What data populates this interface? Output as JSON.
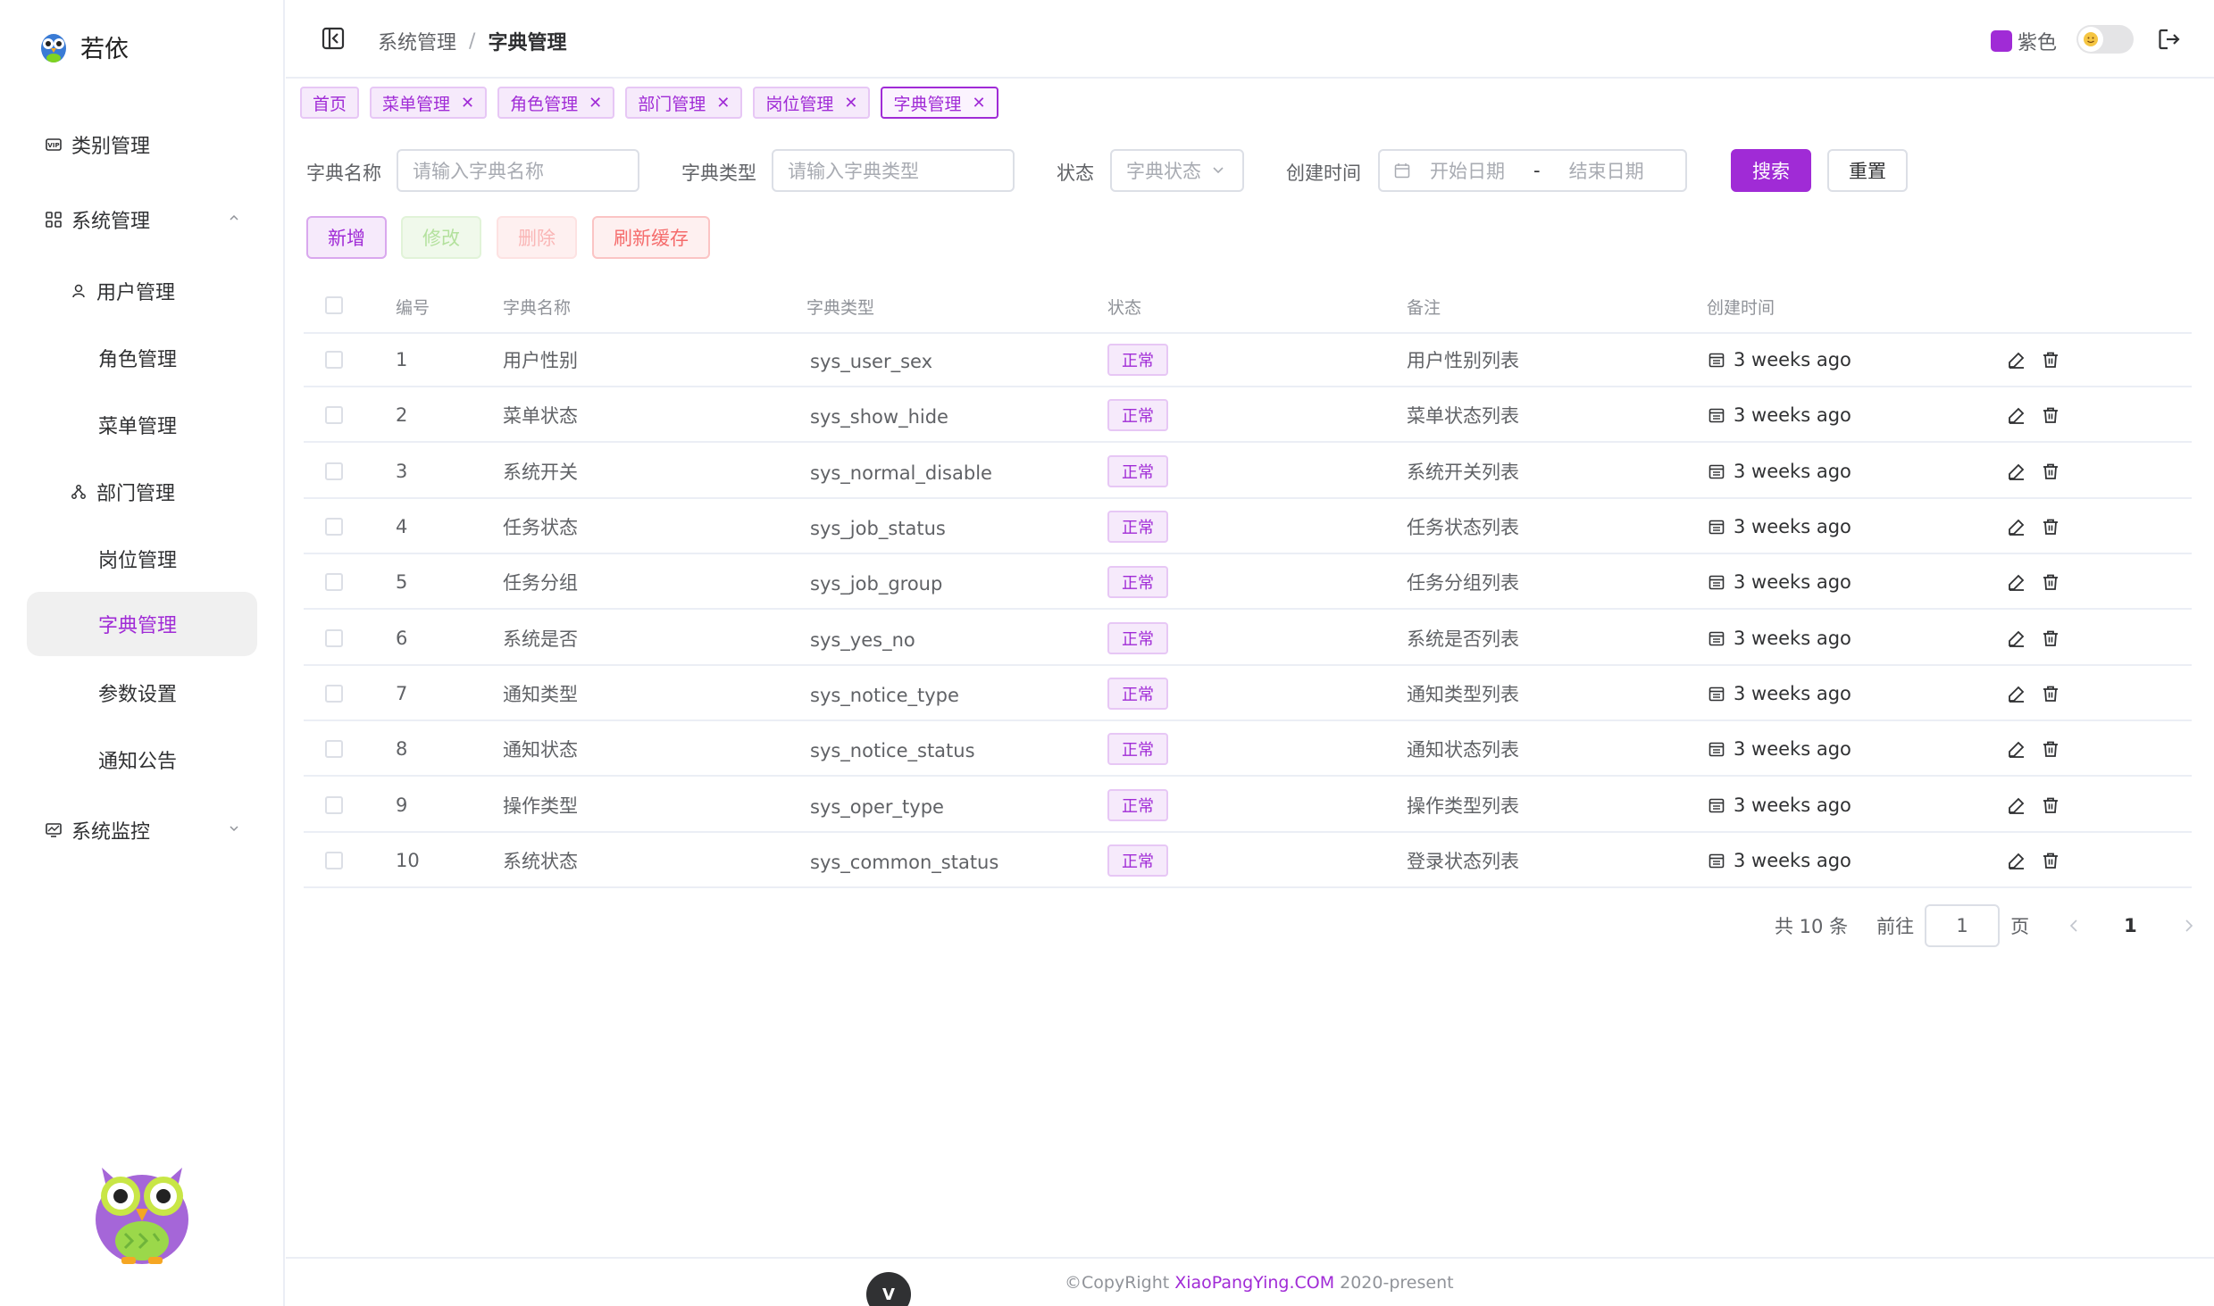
{
  "app": {
    "title": "若依"
  },
  "sidebar": {
    "items": [
      {
        "label": "类别管理",
        "icon": "vip-icon"
      },
      {
        "label": "系统管理",
        "icon": "grid-icon"
      },
      {
        "label": "用户管理",
        "icon": "user-icon"
      },
      {
        "label": "角色管理"
      },
      {
        "label": "菜单管理"
      },
      {
        "label": "部门管理",
        "icon": "tree-icon"
      },
      {
        "label": "岗位管理"
      },
      {
        "label": "字典管理",
        "active": true
      },
      {
        "label": "参数设置"
      },
      {
        "label": "通知公告"
      },
      {
        "label": "系统监控",
        "icon": "monitor-icon"
      }
    ]
  },
  "header": {
    "breadcrumb": [
      "系统管理",
      "字典管理"
    ],
    "breadcrumb_sep": "/",
    "theme_label": "紫色",
    "theme_color": "#a02bd6"
  },
  "tags": [
    {
      "label": "首页",
      "closable": false
    },
    {
      "label": "菜单管理",
      "closable": true
    },
    {
      "label": "角色管理",
      "closable": true
    },
    {
      "label": "部门管理",
      "closable": true
    },
    {
      "label": "岗位管理",
      "closable": true
    },
    {
      "label": "字典管理",
      "closable": true,
      "active": true
    }
  ],
  "search": {
    "name_label": "字典名称",
    "name_placeholder": "请输入字典名称",
    "type_label": "字典类型",
    "type_placeholder": "请输入字典类型",
    "status_label": "状态",
    "status_placeholder": "字典状态",
    "date_label": "创建时间",
    "date_start": "开始日期",
    "date_sep": "-",
    "date_end": "结束日期",
    "search_btn": "搜索",
    "reset_btn": "重置"
  },
  "toolbar": {
    "add": "新增",
    "edit": "修改",
    "delete": "删除",
    "refresh": "刷新缓存"
  },
  "table": {
    "columns": [
      "编号",
      "字典名称",
      "字典类型",
      "状态",
      "备注",
      "创建时间"
    ],
    "rows": [
      {
        "id": "1",
        "name": "用户性别",
        "type": "sys_user_sex",
        "status": "正常",
        "remark": "用户性别列表",
        "created": "3 weeks ago"
      },
      {
        "id": "2",
        "name": "菜单状态",
        "type": "sys_show_hide",
        "status": "正常",
        "remark": "菜单状态列表",
        "created": "3 weeks ago"
      },
      {
        "id": "3",
        "name": "系统开关",
        "type": "sys_normal_disable",
        "status": "正常",
        "remark": "系统开关列表",
        "created": "3 weeks ago"
      },
      {
        "id": "4",
        "name": "任务状态",
        "type": "sys_job_status",
        "status": "正常",
        "remark": "任务状态列表",
        "created": "3 weeks ago"
      },
      {
        "id": "5",
        "name": "任务分组",
        "type": "sys_job_group",
        "status": "正常",
        "remark": "任务分组列表",
        "created": "3 weeks ago"
      },
      {
        "id": "6",
        "name": "系统是否",
        "type": "sys_yes_no",
        "status": "正常",
        "remark": "系统是否列表",
        "created": "3 weeks ago"
      },
      {
        "id": "7",
        "name": "通知类型",
        "type": "sys_notice_type",
        "status": "正常",
        "remark": "通知类型列表",
        "created": "3 weeks ago"
      },
      {
        "id": "8",
        "name": "通知状态",
        "type": "sys_notice_status",
        "status": "正常",
        "remark": "通知状态列表",
        "created": "3 weeks ago"
      },
      {
        "id": "9",
        "name": "操作类型",
        "type": "sys_oper_type",
        "status": "正常",
        "remark": "操作类型列表",
        "created": "3 weeks ago"
      },
      {
        "id": "10",
        "name": "系统状态",
        "type": "sys_common_status",
        "status": "正常",
        "remark": "登录状态列表",
        "created": "3 weeks ago"
      }
    ]
  },
  "pagination": {
    "total": "共 10 条",
    "goto_label": "前往",
    "goto_value": "1",
    "page_unit": "页",
    "current_page": "1"
  },
  "footer": {
    "copyright": "©CopyRight",
    "brand": "XiaoPangYing.COM",
    "years": "2020-present",
    "badge": "V"
  }
}
